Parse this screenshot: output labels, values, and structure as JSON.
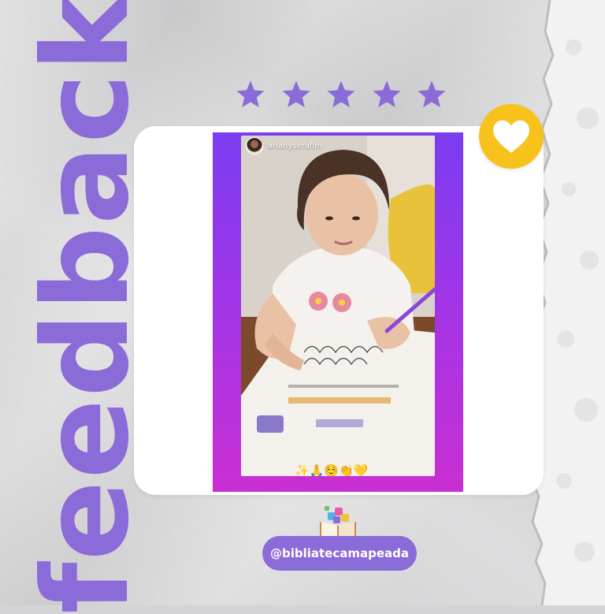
{
  "headline": "feedback",
  "rating": {
    "stars": 5,
    "max": 5
  },
  "story": {
    "username": "arianyserafim",
    "emojis": "✨🙏☺️👏💛"
  },
  "handle": "@bibliatecamapeada",
  "colors": {
    "accent_purple": "#8b6bd8",
    "badge_yellow": "#f7c21c",
    "story_gradient_top": "#7b3cf0",
    "story_gradient_bottom": "#c92fd2",
    "background": "#d4d4d6"
  },
  "icons": [
    "star-icon",
    "heart-icon",
    "open-book-puzzle-icon"
  ]
}
